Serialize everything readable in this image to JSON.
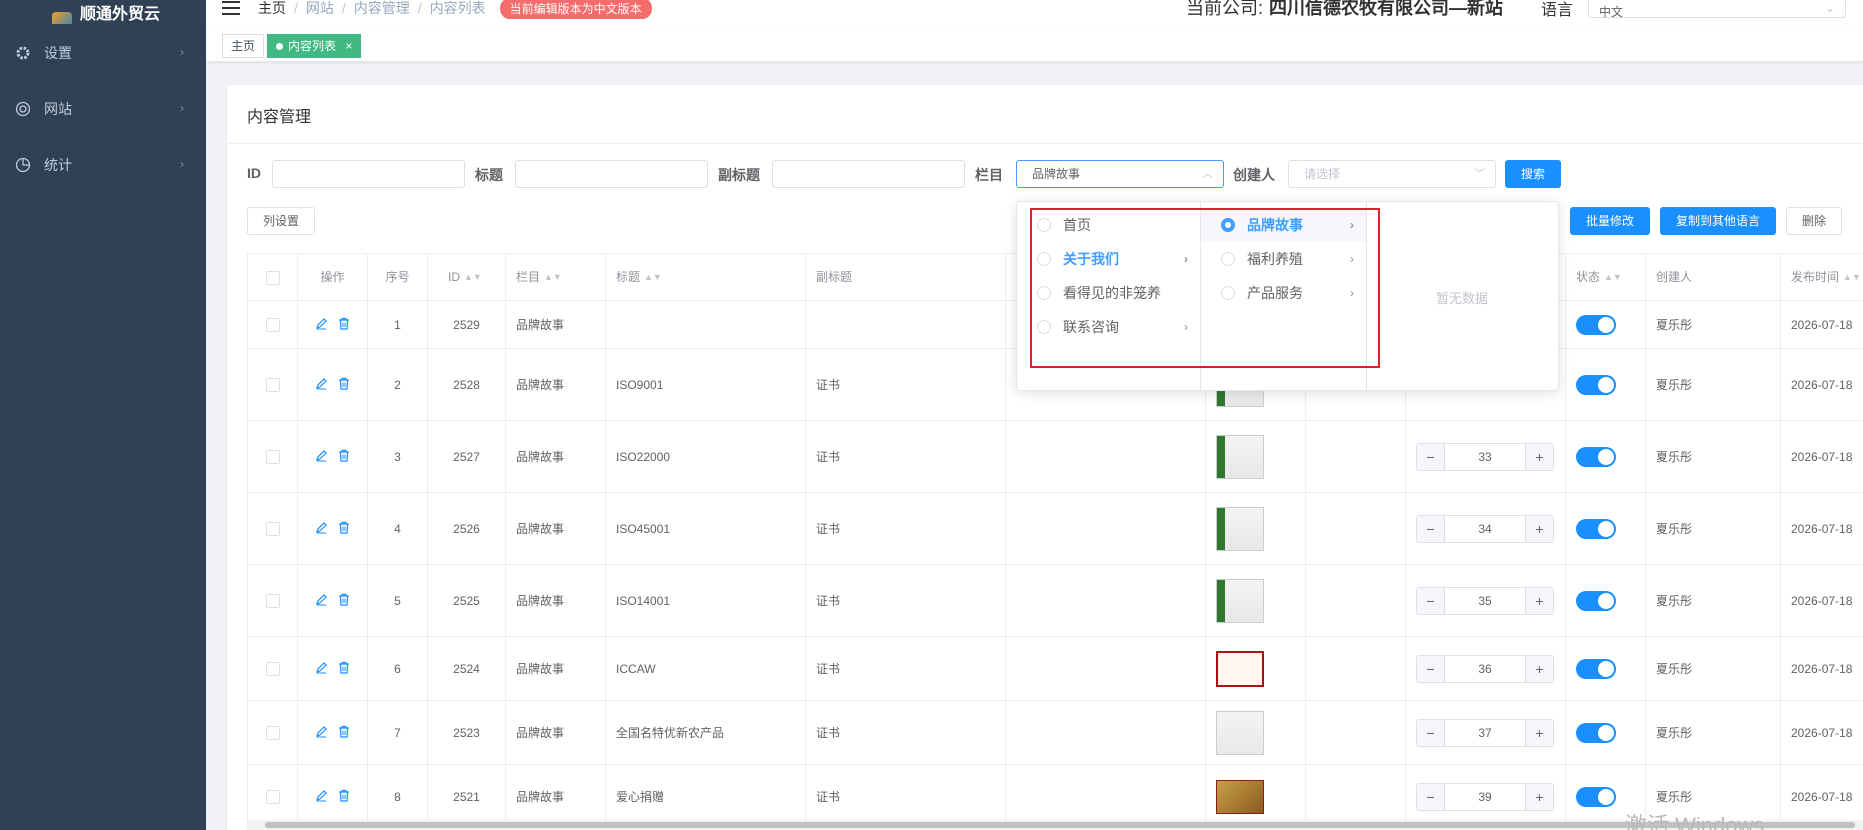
{
  "app": {
    "logo_text": "顺通外贸云"
  },
  "sidebar": {
    "items": [
      {
        "label": "设置",
        "icon": "gear-icon"
      },
      {
        "label": "网站",
        "icon": "globe-icon"
      },
      {
        "label": "统计",
        "icon": "pie-chart-icon"
      }
    ]
  },
  "header": {
    "breadcrumb": [
      "主页",
      "网站",
      "内容管理",
      "内容列表"
    ],
    "version_tag": "当前编辑版本为中文版本",
    "company_label": "当前公司:",
    "company_name": "四川信德农牧有限公司—新站",
    "language_label": "语言",
    "language_value": "中文"
  },
  "tags_view": {
    "home": "主页",
    "active": "内容列表",
    "close": "×"
  },
  "card": {
    "title": "内容管理"
  },
  "filters": {
    "id_label": "ID",
    "id_value": "",
    "title_label": "标题",
    "title_value": "",
    "subtitle_label": "副标题",
    "subtitle_value": "",
    "column_label": "栏目",
    "column_value": "品牌故事",
    "creator_label": "创建人",
    "creator_placeholder": "请选择",
    "search_button": "搜索"
  },
  "toolbar": {
    "column_settings": "列设置",
    "batch_edit": "批量修改",
    "copy_to_language": "复制到其他语言",
    "delete": "删除"
  },
  "table": {
    "headers": {
      "ops": "操作",
      "seq": "序号",
      "id": "ID",
      "column": "栏目",
      "title": "标题",
      "subtitle": "副标题",
      "status": "状态",
      "creator": "创建人",
      "publish_time": "发布时间"
    },
    "rows": [
      {
        "seq": "1",
        "id": "2529",
        "column": "品牌故事",
        "title": "",
        "subtitle": "",
        "sort": "",
        "creator": "夏乐彤",
        "date": "2026-07-18"
      },
      {
        "seq": "2",
        "id": "2528",
        "column": "品牌故事",
        "title": "ISO9001",
        "subtitle": "证书",
        "sort": "",
        "creator": "夏乐彤",
        "date": "2026-07-18"
      },
      {
        "seq": "3",
        "id": "2527",
        "column": "品牌故事",
        "title": "ISO22000",
        "subtitle": "证书",
        "sort": "33",
        "creator": "夏乐彤",
        "date": "2026-07-18"
      },
      {
        "seq": "4",
        "id": "2526",
        "column": "品牌故事",
        "title": "ISO45001",
        "subtitle": "证书",
        "sort": "34",
        "creator": "夏乐彤",
        "date": "2026-07-18"
      },
      {
        "seq": "5",
        "id": "2525",
        "column": "品牌故事",
        "title": "ISO14001",
        "subtitle": "证书",
        "sort": "35",
        "creator": "夏乐彤",
        "date": "2026-07-18"
      },
      {
        "seq": "6",
        "id": "2524",
        "column": "品牌故事",
        "title": "ICCAW",
        "subtitle": "证书",
        "sort": "36",
        "creator": "夏乐彤",
        "date": "2026-07-18"
      },
      {
        "seq": "7",
        "id": "2523",
        "column": "品牌故事",
        "title": "全国名特优新农产品",
        "subtitle": "证书",
        "sort": "37",
        "creator": "夏乐彤",
        "date": "2026-07-18"
      },
      {
        "seq": "8",
        "id": "2521",
        "column": "品牌故事",
        "title": "爱心捐赠",
        "subtitle": "证书",
        "sort": "39",
        "creator": "夏乐彤",
        "date": "2026-07-18"
      }
    ]
  },
  "cascader": {
    "level1": [
      "首页",
      "关于我们",
      "看得见的非笼养",
      "联系咨询"
    ],
    "level2": [
      "品牌故事",
      "福利养殖",
      "产品服务"
    ],
    "empty_text": "暂无数据"
  },
  "colors": {
    "primary": "#1890ff",
    "sidebar": "#304156",
    "danger": "#f56c6c",
    "highlight_box": "#d9232d"
  },
  "watermark": "激活 Windows"
}
